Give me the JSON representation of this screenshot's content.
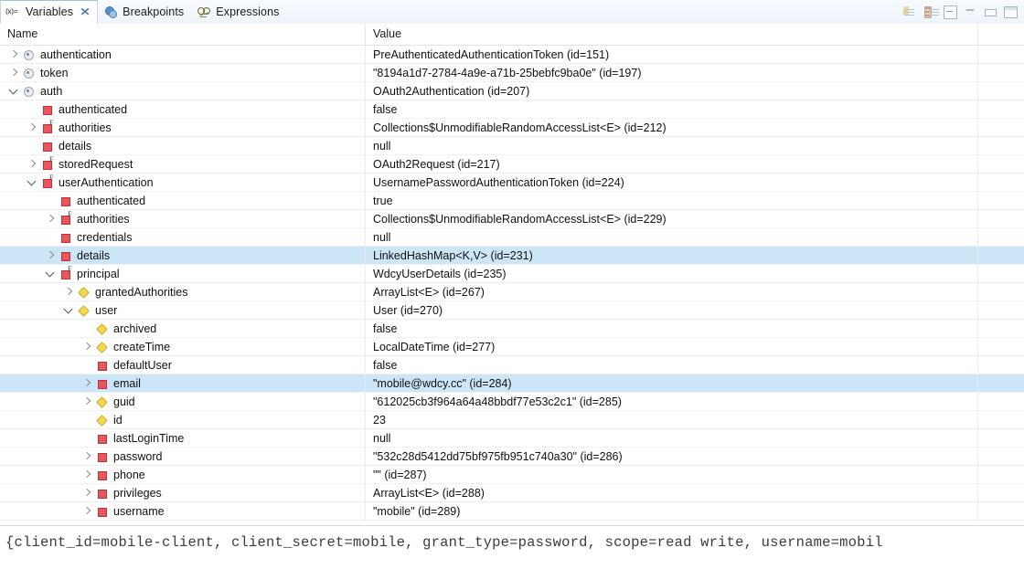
{
  "view": {
    "tabs": [
      {
        "label": "Variables",
        "icon": "variables-icon",
        "active": true,
        "closable": true
      },
      {
        "label": "Breakpoints",
        "icon": "breakpoints-icon",
        "active": false,
        "closable": false
      },
      {
        "label": "Expressions",
        "icon": "expressions-icon",
        "active": false,
        "closable": false
      }
    ],
    "close_glyph": "✕",
    "toolbar": [
      {
        "name": "show-logical-structure-button",
        "icon": "logical-structure-icon"
      },
      {
        "name": "collapse-all-button",
        "icon": "collapse-all-icon"
      },
      {
        "name": "layout-button",
        "icon": "layout-panes-icon"
      },
      {
        "name": "view-menu-button",
        "icon": "chevron-down-icon"
      },
      {
        "name": "minimize-button",
        "icon": "minimize-icon"
      },
      {
        "name": "maximize-button",
        "icon": "maximize-icon"
      }
    ]
  },
  "table": {
    "columns": {
      "name": "Name",
      "value": "Value"
    },
    "rows": [
      {
        "indent": 0,
        "twisty": "collapsed",
        "icon": "obj",
        "final": false,
        "name": "authentication",
        "value": "PreAuthenticatedAuthenticationToken  (id=151)",
        "selected": false
      },
      {
        "indent": 0,
        "twisty": "collapsed",
        "icon": "obj",
        "final": false,
        "name": "token",
        "value": "\"8194a1d7-2784-4a9e-a71b-25bebfc9ba0e\" (id=197)",
        "selected": false
      },
      {
        "indent": 0,
        "twisty": "expanded",
        "icon": "obj",
        "final": false,
        "name": "auth",
        "value": "OAuth2Authentication  (id=207)",
        "selected": false
      },
      {
        "indent": 1,
        "twisty": "none",
        "icon": "priv",
        "final": false,
        "name": "authenticated",
        "value": "false",
        "selected": false
      },
      {
        "indent": 1,
        "twisty": "collapsed",
        "icon": "priv",
        "final": true,
        "name": "authorities",
        "value": "Collections$UnmodifiableRandomAccessList<E>  (id=212)",
        "selected": false
      },
      {
        "indent": 1,
        "twisty": "none",
        "icon": "priv",
        "final": false,
        "name": "details",
        "value": "null",
        "selected": false
      },
      {
        "indent": 1,
        "twisty": "collapsed",
        "icon": "priv",
        "final": true,
        "name": "storedRequest",
        "value": "OAuth2Request  (id=217)",
        "selected": false
      },
      {
        "indent": 1,
        "twisty": "expanded",
        "icon": "priv",
        "final": true,
        "name": "userAuthentication",
        "value": "UsernamePasswordAuthenticationToken  (id=224)",
        "selected": false
      },
      {
        "indent": 2,
        "twisty": "none",
        "icon": "priv",
        "final": false,
        "name": "authenticated",
        "value": "true",
        "selected": false
      },
      {
        "indent": 2,
        "twisty": "collapsed",
        "icon": "priv",
        "final": true,
        "name": "authorities",
        "value": "Collections$UnmodifiableRandomAccessList<E>  (id=229)",
        "selected": false
      },
      {
        "indent": 2,
        "twisty": "none",
        "icon": "priv",
        "final": false,
        "name": "credentials",
        "value": "null",
        "selected": false
      },
      {
        "indent": 2,
        "twisty": "collapsed",
        "icon": "priv",
        "final": false,
        "name": "details",
        "value": "LinkedHashMap<K,V>  (id=231)",
        "selected": true
      },
      {
        "indent": 2,
        "twisty": "expanded",
        "icon": "priv",
        "final": true,
        "name": "principal",
        "value": "WdcyUserDetails  (id=235)",
        "selected": false
      },
      {
        "indent": 3,
        "twisty": "collapsed",
        "icon": "def",
        "final": false,
        "name": "grantedAuthorities",
        "value": "ArrayList<E>  (id=267)",
        "selected": false
      },
      {
        "indent": 3,
        "twisty": "expanded",
        "icon": "def",
        "final": false,
        "name": "user",
        "value": "User  (id=270)",
        "selected": false
      },
      {
        "indent": 4,
        "twisty": "none",
        "icon": "def",
        "final": false,
        "name": "archived",
        "value": "false",
        "selected": false
      },
      {
        "indent": 4,
        "twisty": "collapsed",
        "icon": "def",
        "final": false,
        "name": "createTime",
        "value": "LocalDateTime  (id=277)",
        "selected": false
      },
      {
        "indent": 4,
        "twisty": "none",
        "icon": "priv",
        "final": false,
        "name": "defaultUser",
        "value": "false",
        "selected": false
      },
      {
        "indent": 4,
        "twisty": "collapsed",
        "icon": "priv",
        "final": false,
        "name": "email",
        "value": "\"mobile@wdcy.cc\" (id=284)",
        "selected": true
      },
      {
        "indent": 4,
        "twisty": "collapsed",
        "icon": "def",
        "final": false,
        "name": "guid",
        "value": "\"612025cb3f964a64a48bbdf77e53c2c1\" (id=285)",
        "selected": false
      },
      {
        "indent": 4,
        "twisty": "none",
        "icon": "def",
        "final": false,
        "name": "id",
        "value": "23",
        "selected": false
      },
      {
        "indent": 4,
        "twisty": "none",
        "icon": "priv",
        "final": false,
        "name": "lastLoginTime",
        "value": "null",
        "selected": false
      },
      {
        "indent": 4,
        "twisty": "collapsed",
        "icon": "priv",
        "final": false,
        "name": "password",
        "value": "\"532c28d5412dd75bf975fb951c740a30\" (id=286)",
        "selected": false
      },
      {
        "indent": 4,
        "twisty": "collapsed",
        "icon": "priv",
        "final": false,
        "name": "phone",
        "value": "\"\" (id=287)",
        "selected": false
      },
      {
        "indent": 4,
        "twisty": "collapsed",
        "icon": "priv",
        "final": false,
        "name": "privileges",
        "value": "ArrayList<E>  (id=288)",
        "selected": false
      },
      {
        "indent": 4,
        "twisty": "collapsed",
        "icon": "priv",
        "final": false,
        "name": "username",
        "value": "\"mobile\" (id=289)",
        "selected": false
      }
    ]
  },
  "detail_pane": {
    "text": "{client_id=mobile-client, client_secret=mobile, grant_type=password, scope=read write, username=mobil"
  }
}
